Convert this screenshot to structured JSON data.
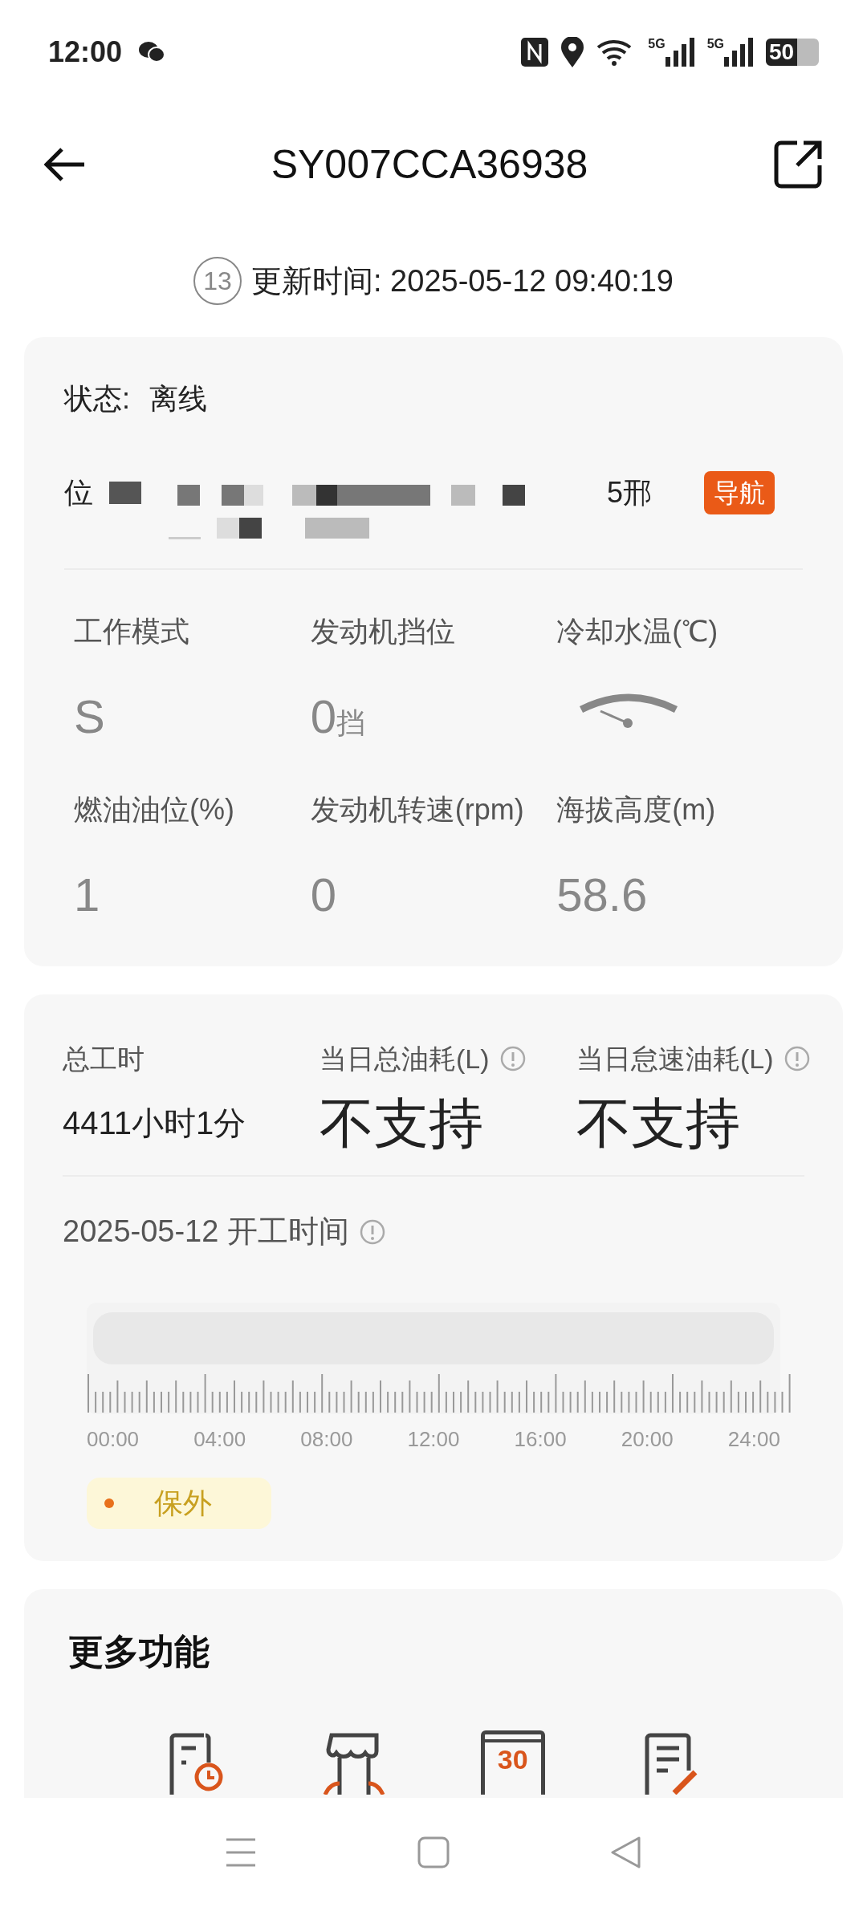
{
  "status_bar": {
    "time": "12:00",
    "networks": [
      "5G",
      "5G"
    ],
    "battery": "50"
  },
  "header": {
    "title": "SY007CCA36938"
  },
  "update": {
    "badge": "13",
    "text": "更新时间: 2025-05-12 09:40:19"
  },
  "info": {
    "status_label": "状态:",
    "status_value": "离线",
    "location_label": "位",
    "location_tail": "5邢",
    "nav_button": "导航"
  },
  "metrics": [
    {
      "kind": "text",
      "label": "工作模式",
      "value": "S"
    },
    {
      "kind": "unit",
      "label": "发动机挡位",
      "value": "0",
      "unit": "挡"
    },
    {
      "kind": "gauge",
      "label": "冷却水温(℃)"
    },
    {
      "kind": "text",
      "label": "燃油油位(%)",
      "value": "1"
    },
    {
      "kind": "text",
      "label": "发动机转速(rpm)",
      "value": "0"
    },
    {
      "kind": "text",
      "label": "海拔高度(m)",
      "value": "58.6"
    }
  ],
  "usage": [
    {
      "label": "总工时",
      "value": "4411小时1分",
      "info": false
    },
    {
      "label": "当日总油耗(L)",
      "value": "不支持",
      "info": true
    },
    {
      "label": "当日怠速油耗(L)",
      "value": "不支持",
      "info": true
    }
  ],
  "worktime": {
    "title": "2025-05-12 开工时间",
    "time_labels": [
      "00:00",
      "04:00",
      "08:00",
      "12:00",
      "16:00",
      "20:00",
      "24:00"
    ],
    "legend": [
      {
        "label": "保外",
        "color": "#e8711c"
      }
    ]
  },
  "more": {
    "title": "更多功能",
    "items": [
      {
        "kind": "clock"
      },
      {
        "kind": "shop"
      },
      {
        "kind": "calendar",
        "icon_text": "30"
      },
      {
        "kind": "edit"
      }
    ]
  }
}
